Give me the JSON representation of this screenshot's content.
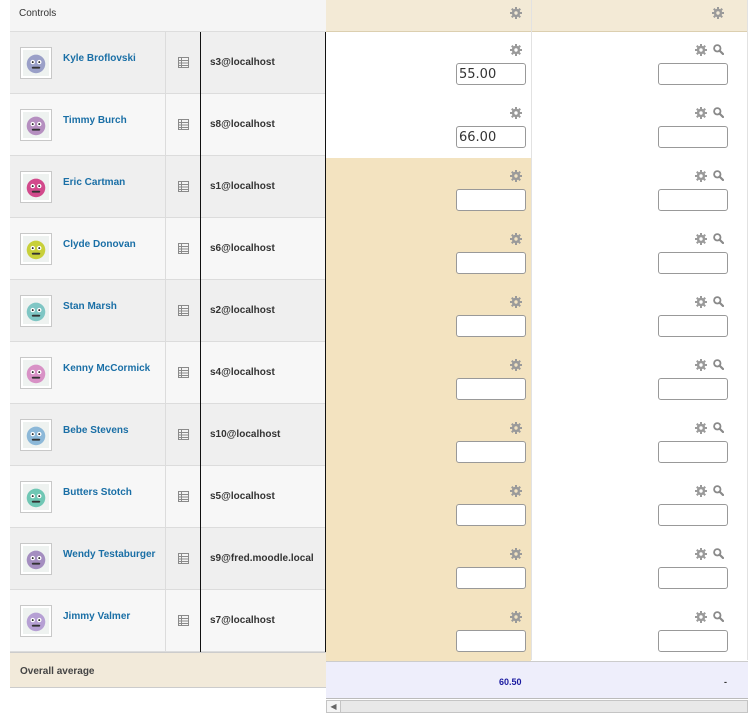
{
  "controls_label": "Controls",
  "overall_label": "Overall average",
  "averages": [
    "60.50",
    "-"
  ],
  "icons": {
    "settings": "gear-icon",
    "search": "magnifier-icon",
    "report": "grid-report-icon",
    "scroll_left": "arrow-left-icon"
  },
  "colors": {
    "link": "#1a6fa6",
    "overridden_cell": "#f3e3c0",
    "header": "#f3ead6",
    "average_row": "#eeeefb"
  },
  "users": [
    {
      "name": "Kyle Broflovski",
      "email": "s3@localhost",
      "grade1": "55.00",
      "grade2": "",
      "avatar_color": "#9aa0c8"
    },
    {
      "name": "Timmy Burch",
      "email": "s8@localhost",
      "grade1": "66.00",
      "grade2": "",
      "avatar_color": "#b58fc0"
    },
    {
      "name": "Eric Cartman",
      "email": "s1@localhost",
      "grade1": "",
      "grade2": "",
      "avatar_color": "#d24a8c"
    },
    {
      "name": "Clyde Donovan",
      "email": "s6@localhost",
      "grade1": "",
      "grade2": "",
      "avatar_color": "#c8d03a"
    },
    {
      "name": "Stan Marsh",
      "email": "s2@localhost",
      "grade1": "",
      "grade2": "",
      "avatar_color": "#7fc6c4"
    },
    {
      "name": "Kenny McCormick",
      "email": "s4@localhost",
      "grade1": "",
      "grade2": "",
      "avatar_color": "#d892c6"
    },
    {
      "name": "Bebe Stevens",
      "email": "s10@localhost",
      "grade1": "",
      "grade2": "",
      "avatar_color": "#8cb8d8"
    },
    {
      "name": "Butters Stotch",
      "email": "s5@localhost",
      "grade1": "",
      "grade2": "",
      "avatar_color": "#6fc7b4"
    },
    {
      "name": "Wendy Testaburger",
      "email": "s9@fred.moodle.local",
      "grade1": "",
      "grade2": "",
      "avatar_color": "#a48ec0"
    },
    {
      "name": "Jimmy Valmer",
      "email": "s7@localhost",
      "grade1": "",
      "grade2": "",
      "avatar_color": "#b6a0d4"
    }
  ]
}
